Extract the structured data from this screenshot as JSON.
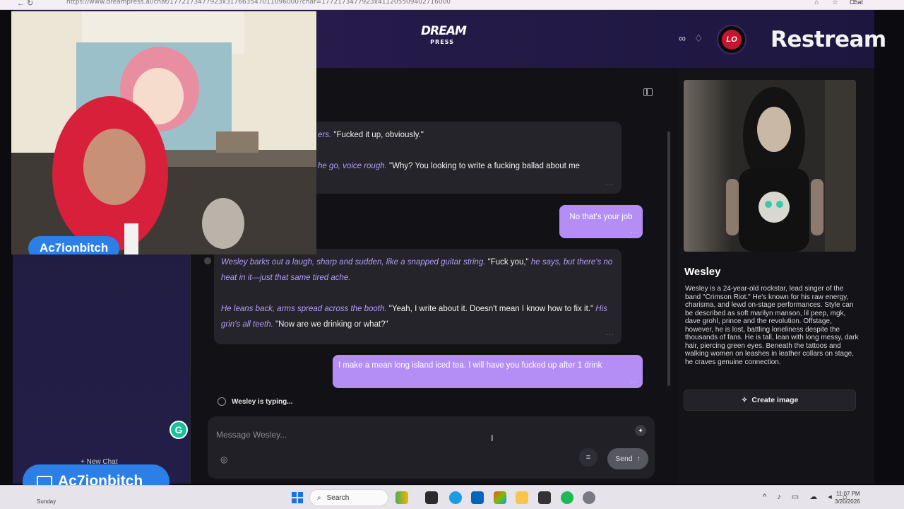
{
  "browser": {
    "url": "https://www.dreampress.ai/chat/1772173477923x317663547011096000?char=1772173477923x411205509402716000",
    "nav_glyphs": "←  ↻",
    "chat_label": "Chat"
  },
  "header": {
    "logo_line1": "DREAM",
    "logo_line2": "PRESS",
    "icons_text": "∞ ♢",
    "avatar_initials": "LO",
    "overlay_brand": "Restream"
  },
  "webcam": {
    "label": "Ac7ionbitch"
  },
  "stream_badge": {
    "label": "Ac7ionbitch"
  },
  "sidebar": {
    "new_chat_label": "+ New Chat"
  },
  "chat": {
    "messages": [
      {
        "role": "ai",
        "parts": [
          {
            "t": "act",
            "text": "ers."
          },
          {
            "t": "txt",
            "text": " \"Fucked it up, obviously.\""
          }
        ],
        "parts2": [
          {
            "t": "act",
            "text": "he go, voice rough."
          },
          {
            "t": "txt",
            "text": " \"Why? You looking to write a fucking ballad about me"
          }
        ]
      },
      {
        "role": "user",
        "text": "No that's your job"
      },
      {
        "role": "ai",
        "p1a": "Wesley barks out a laugh, sharp and sudden, like a snapped guitar string.",
        "p1b": " \"Fuck you,\" ",
        "p1c": "he says, but there's no heat in it—just that same tired ache.",
        "p2a": "He leans back, arms spread across the booth.",
        "p2b": " \"Yeah, I write about it. Doesn't mean I know how to fix it.\" ",
        "p2c": "His grin's all teeth.",
        "p2d": " \"Now are we drinking or what?\""
      },
      {
        "role": "user",
        "text": "I make a mean long island iced tea. I will have you fucked up after 1 drink"
      }
    ],
    "typing_text": "Wesley is typing...",
    "composer_placeholder": "Message Wesley...",
    "send_label": "Send"
  },
  "character": {
    "name": "Wesley",
    "description": "Wesley is a 24-year-old rockstar, lead singer of the band \"Crimson Riot.\" He's known for his raw energy, charisma, and lewd on-stage performances. Style can be described as soft marilyn manson, lil peep, mgk, dave grohl, prince and the revolution. Offstage, however, he is lost, battling loneliness despite the thousands of fans. He is tall, lean with long messy, dark hair, piercing green eyes. Beneath the tattoos and walking women on leashes in leather collars on stage, he craves genuine connection.",
    "create_image_label": "Create image"
  },
  "taskbar": {
    "weather": "Sunday",
    "search_label": "Search",
    "time": "11:07 PM",
    "date": "3/20/2026"
  },
  "colors": {
    "accent_user_bubble": "#b58ef5",
    "action_text": "#b39bff",
    "restream_blue": "#2b7fe6",
    "header_purple": "#2a1d52"
  }
}
